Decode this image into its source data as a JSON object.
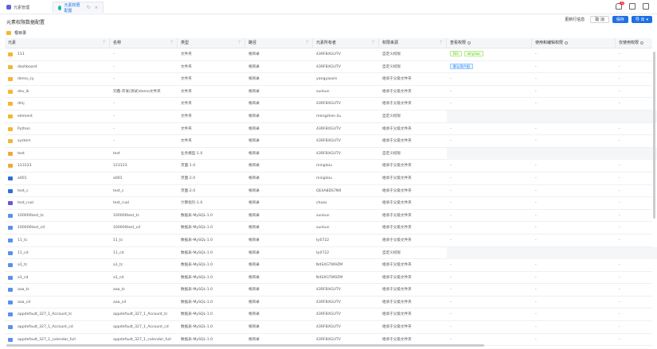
{
  "tabs": [
    {
      "label": "元素管理"
    },
    {
      "label": "元素权限配置",
      "close": "×",
      "refresh": "↻"
    }
  ],
  "notifications": {
    "count": "10"
  },
  "page": {
    "title": "元素权限数据配置"
  },
  "toolbar": {
    "batch_label": "更新行信息",
    "cancel_label": "取 消",
    "save_label": "保存",
    "export_label": "导 出"
  },
  "breadcrumb": {
    "label": "根目录"
  },
  "columns": [
    "元素",
    "名称",
    "类型",
    "路径",
    "元素所有者",
    "权限来源",
    "查看权限",
    "使用和编辑权限",
    "仅使用权限"
  ],
  "rows": [
    {
      "icon": "folder",
      "element": "111",
      "name": "-",
      "type": "文件夹",
      "path": "根目录",
      "owner": "43RFBXGUTV",
      "source": "自定义权限",
      "view": "tags1",
      "edit": "-",
      "use": "-"
    },
    {
      "icon": "folder",
      "element": "dashboard",
      "name": "-",
      "type": "文件夹",
      "path": "根目录",
      "owner": "43RFBXGUTV",
      "source": "自定义权限",
      "view": "tags2",
      "edit": "-",
      "use": "-"
    },
    {
      "icon": "folder",
      "element": "demo_cy",
      "name": "-",
      "type": "文件夹",
      "path": "根目录",
      "owner": "yangyaoxin",
      "source": "继承于父级文件夹",
      "view": "-",
      "edit": "-",
      "use": "-"
    },
    {
      "icon": "folder",
      "element": "dev_lk",
      "name": "刘鑫-开发(测试)demo文件夹",
      "type": "文件夹",
      "path": "根目录",
      "owner": "sunkun",
      "source": "继承于父级文件夹",
      "view": "-",
      "edit": "-",
      "use": "-"
    },
    {
      "icon": "folder",
      "element": "dmj",
      "name": "-",
      "type": "文件夹",
      "path": "根目录",
      "owner": "43RFBXGUTV",
      "source": "继承于父级文件夹",
      "view": "-",
      "edit": "-",
      "use": "-"
    },
    {
      "icon": "folder",
      "element": "element",
      "name": "-",
      "type": "文件夹",
      "path": "根目录",
      "owner": "mengzhen.liu",
      "source": "自定义权限",
      "view": "",
      "edit": "",
      "use": ""
    },
    {
      "icon": "folder",
      "element": "Python",
      "name": "-",
      "type": "文件夹",
      "path": "根目录",
      "owner": "43RFBXGUTV",
      "source": "继承于父级文件夹",
      "view": "-",
      "edit": "-",
      "use": "-"
    },
    {
      "icon": "folder",
      "element": "system",
      "name": "-",
      "type": "文件夹",
      "path": "根目录",
      "owner": "43RFBXGUTV",
      "source": "继承于父级文件夹",
      "view": "-",
      "edit": "-",
      "use": "-"
    },
    {
      "icon": "biz",
      "element": "test",
      "name": "test",
      "type": "业务模型-1.0",
      "path": "根目录",
      "owner": "43RFBXGUTV",
      "source": "自定义权限",
      "view": "",
      "edit": "",
      "use": ""
    },
    {
      "icon": "biz",
      "element": "123123",
      "name": "123123",
      "type": "页面-1.0",
      "path": "根目录",
      "owner": "minglaiu",
      "source": "继承于父级文件夹",
      "view": "-",
      "edit": "-",
      "use": "-"
    },
    {
      "icon": "page",
      "element": "a001",
      "name": "a001",
      "type": "页面-2.0",
      "path": "根目录",
      "owner": "minglaiu",
      "source": "继承于父级文件夹",
      "view": "-",
      "edit": "-",
      "use": "-"
    },
    {
      "icon": "page",
      "element": "test_c",
      "name": "test_c",
      "type": "页面-2.0",
      "path": "根目录",
      "owner": "QE4A8DS7N9",
      "source": "继承于父级文件夹",
      "view": "-",
      "edit": "-",
      "use": "-"
    },
    {
      "icon": "calc",
      "element": "test_rual",
      "name": "test_rual",
      "type": "计算指引-1.0",
      "path": "根目录",
      "owner": "chaas",
      "source": "继承于父级文件夹",
      "view": "-",
      "edit": "-",
      "use": "-"
    },
    {
      "icon": "data",
      "element": "100000test_tc",
      "name": "100000test_tc",
      "type": "数据表-MySQL-1.0",
      "path": "根目录",
      "owner": "sunkun",
      "source": "继承于父级文件夹",
      "view": "-",
      "edit": "-",
      "use": "-"
    },
    {
      "icon": "data",
      "element": "100000test_cd",
      "name": "100000test_cd",
      "type": "数据表-MySQL-1.0",
      "path": "根目录",
      "owner": "sunkun",
      "source": "继承于父级文件夹",
      "view": "-",
      "edit": "-",
      "use": "-"
    },
    {
      "icon": "data",
      "element": "11_tc",
      "name": "11_tc",
      "type": "数据表-MySQL-1.0",
      "path": "根目录",
      "owner": "ty0722",
      "source": "继承于父级文件夹",
      "view": "-",
      "edit": "-",
      "use": "-"
    },
    {
      "icon": "data",
      "element": "11_cd",
      "name": "11_cd",
      "type": "数据表-MySQL-1.0",
      "path": "根目录",
      "owner": "ty0722",
      "source": "自定义权限",
      "view": "",
      "edit": "",
      "use": ""
    },
    {
      "icon": "data",
      "element": "a1_tc",
      "name": "a1_tc",
      "type": "数据表-MySQL-1.0",
      "path": "根目录",
      "owner": "N4SXGTW9ZM",
      "source": "继承于父级文件夹",
      "view": "-",
      "edit": "-",
      "use": "-"
    },
    {
      "icon": "data",
      "element": "a1_cd",
      "name": "a1_cd",
      "type": "数据表-MySQL-1.0",
      "path": "根目录",
      "owner": "N4SXGTW9ZM",
      "source": "继承于父级文件夹",
      "view": "-",
      "edit": "-",
      "use": "-"
    },
    {
      "icon": "data",
      "element": "aaa_tc",
      "name": "aaa_tc",
      "type": "数据表-MySQL-1.0",
      "path": "根目录",
      "owner": "43RFBXGUTV",
      "source": "继承于父级文件夹",
      "view": "-",
      "edit": "-",
      "use": "-"
    },
    {
      "icon": "data",
      "element": "aaa_cd",
      "name": "aaa_cd",
      "type": "数据表-MySQL-1.0",
      "path": "根目录",
      "owner": "43RFBXGUTV",
      "source": "继承于父级文件夹",
      "view": "-",
      "edit": "-",
      "use": "-"
    },
    {
      "icon": "data",
      "element": "appdefault_327_1_Account_tc",
      "name": "appdefault_327_1_Account_tc",
      "type": "数据表-MySQL-1.0",
      "path": "根目录",
      "owner": "43RFBXGUTV",
      "source": "继承于父级文件夹",
      "view": "-",
      "edit": "-",
      "use": "-"
    },
    {
      "icon": "data",
      "element": "appdefault_327_1_Account_cd",
      "name": "appdefault_327_1_Account_cd",
      "type": "数据表-MySQL-1.0",
      "path": "根目录",
      "owner": "43RFBXGUTV",
      "source": "继承于父级文件夹",
      "view": "-",
      "edit": "-",
      "use": "-"
    },
    {
      "icon": "data",
      "element": "appdefault_327_1_calendar_full",
      "name": "appdefault_327_1_calendar_full",
      "type": "数据表-MySQL-1.0",
      "path": "根目录",
      "owner": "43RFBXGUTV",
      "source": "继承于父级文件夹",
      "view": "-",
      "edit": "-",
      "use": "-"
    }
  ],
  "view_tags": {
    "tags1": [
      {
        "text": "Dili",
        "style": "green"
      },
      {
        "text": "whyliao",
        "style": "green"
      }
    ],
    "tags2": [
      {
        "text": "默认用户组",
        "style": "blue"
      }
    ]
  },
  "colors": {
    "primary": "#1f6fe5",
    "folder": "#f5b531",
    "tag_green": "#52c41a",
    "tag_blue": "#1677ff"
  }
}
